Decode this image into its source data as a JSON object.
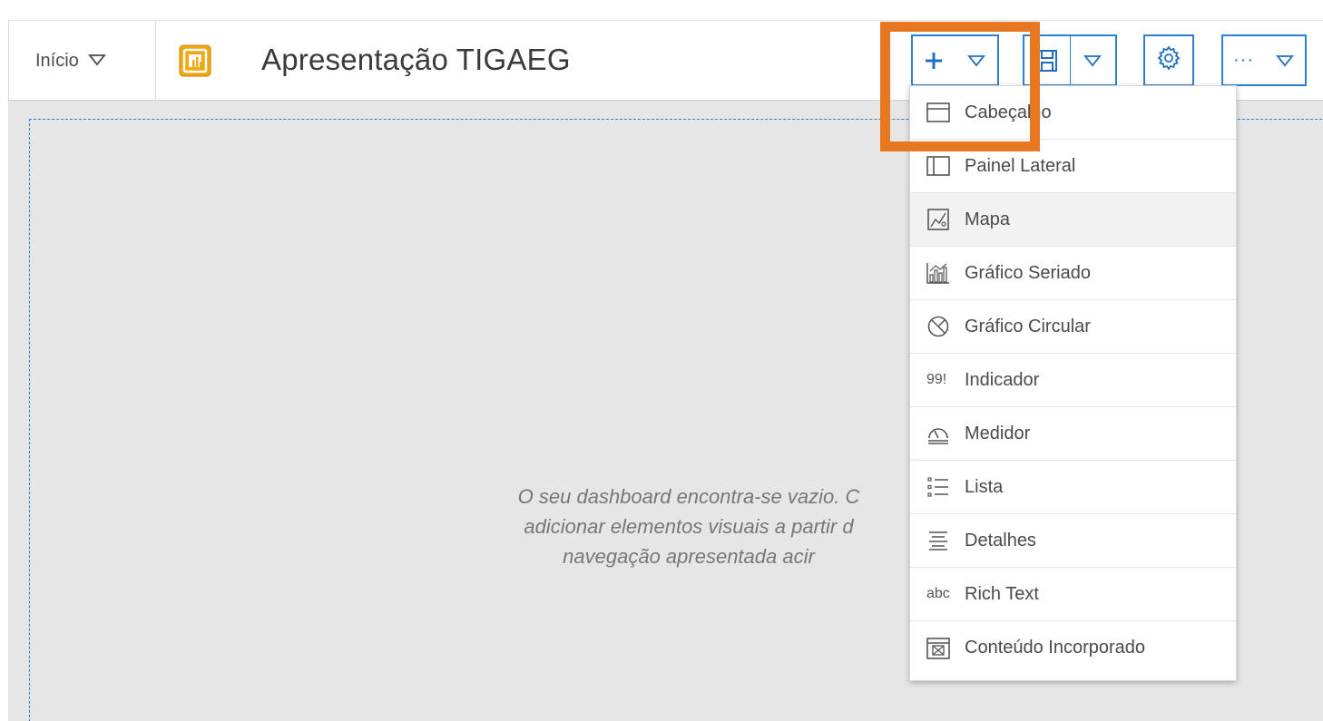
{
  "header": {
    "home_label": "Início",
    "app_title": "Apresentação TIGAEG"
  },
  "toolbar": {
    "add_icon": "plus-icon",
    "save_icon": "save-icon",
    "settings_icon": "gear-icon",
    "more_icon": "ellipsis-icon",
    "more_label": "···"
  },
  "canvas": {
    "empty_message_line1": "O seu dashboard encontra-se vazio. C",
    "empty_message_line2": "adicionar elementos visuais a partir d",
    "empty_message_line3": "navegação apresentada acir"
  },
  "menu": {
    "items": [
      {
        "label": "Cabeçalho",
        "icon": "header-icon"
      },
      {
        "label": "Painel Lateral",
        "icon": "side-panel-icon"
      },
      {
        "label": "Mapa",
        "icon": "map-icon"
      },
      {
        "label": "Gráfico Seriado",
        "icon": "serial-chart-icon"
      },
      {
        "label": "Gráfico Circular",
        "icon": "pie-chart-icon"
      },
      {
        "label": "Indicador",
        "icon": "indicator-icon",
        "icon_text": "99!"
      },
      {
        "label": "Medidor",
        "icon": "gauge-icon"
      },
      {
        "label": "Lista",
        "icon": "list-icon"
      },
      {
        "label": "Detalhes",
        "icon": "details-icon"
      },
      {
        "label": "Rich Text",
        "icon": "rich-text-icon",
        "icon_text": "abc"
      },
      {
        "label": "Conteúdo Incorporado",
        "icon": "embedded-content-icon"
      }
    ]
  },
  "colors": {
    "accent_blue": "#2b7fd4",
    "highlight_orange": "#e87722",
    "logo_gold": "#f0a814",
    "canvas_gray": "#e6e6e6"
  }
}
